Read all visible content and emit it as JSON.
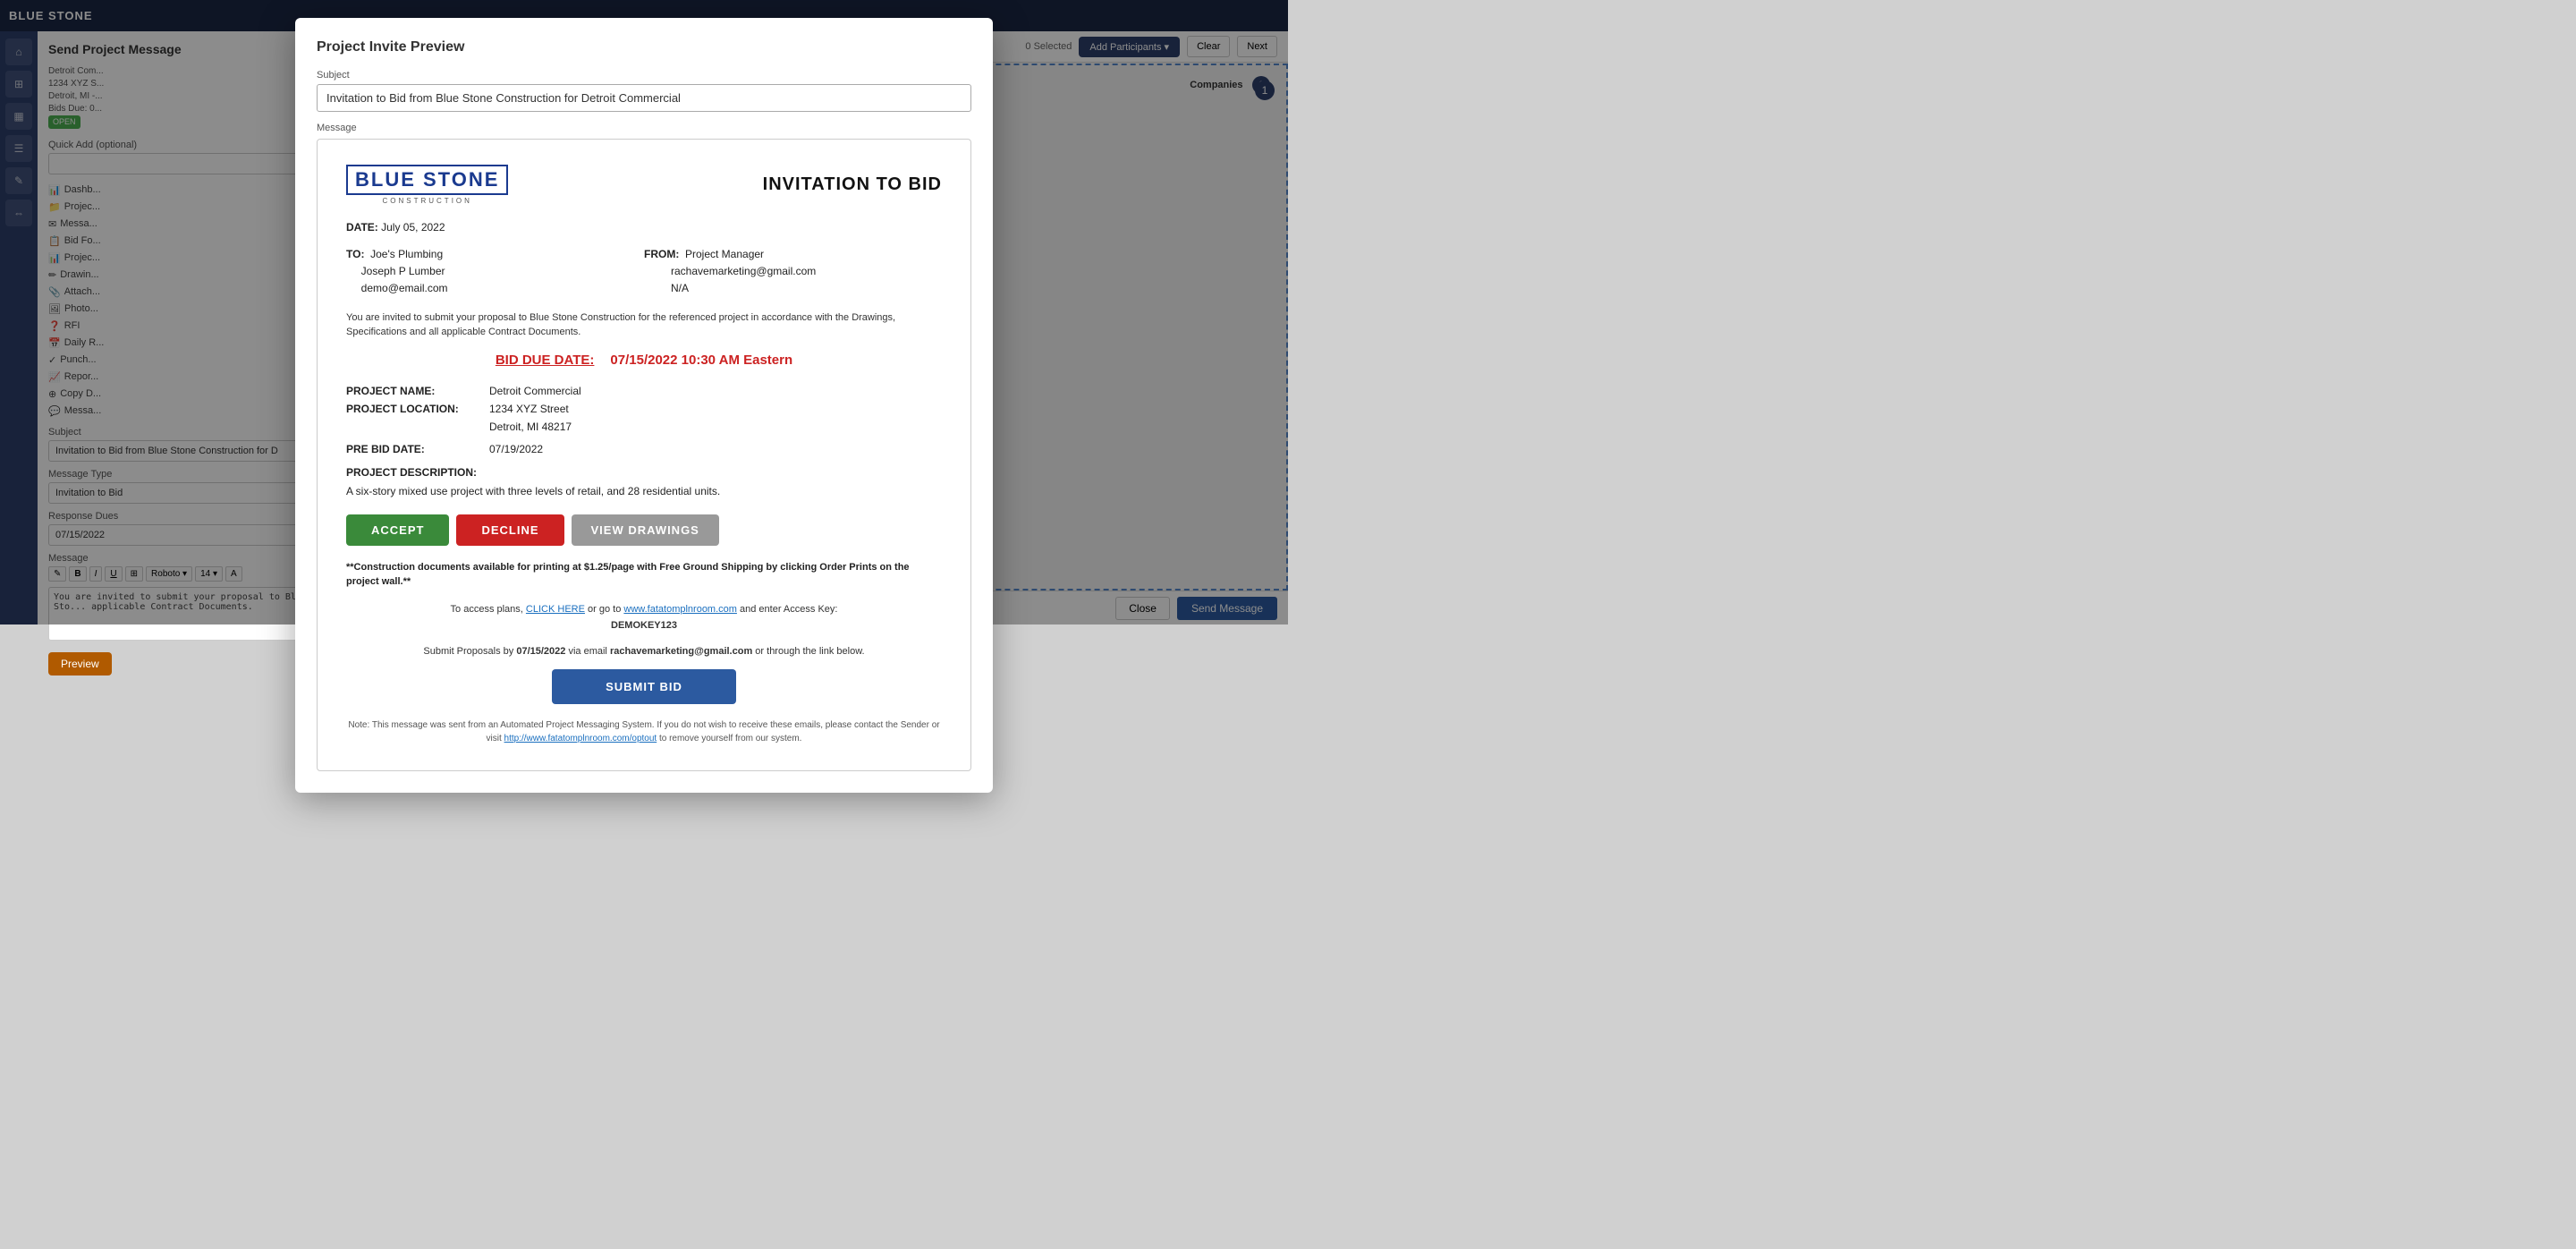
{
  "app": {
    "logo": "BLUE STONE",
    "title": "Send Project Message"
  },
  "send_panel": {
    "title": "Send Project Message",
    "project_info": {
      "company": "Detroit Com...",
      "address": "1234 XYZ S...",
      "city": "Detroit, MI -...",
      "bids_due": "Bids Due: 0...",
      "status": "OPEN"
    },
    "quick_add_label": "Quick Add (optional)",
    "quick_add_placeholder": "",
    "subject_label": "Subject",
    "subject_value": "Invitation to Bid from Blue Stone Construction for D",
    "message_type_label": "Message Type",
    "message_type_value": "Invitation to Bid",
    "response_dues_label": "Response Dues",
    "response_dues_value": "07/15/2022",
    "message_label": "Message",
    "message_body": "You are invited to submit your proposal to Blue Sto... applicable Contract Documents.",
    "toolbar_buttons": [
      "bold",
      "italic",
      "underline",
      "image",
      "font",
      "size",
      "color"
    ],
    "preview_label": "Preview"
  },
  "nav_links": [
    {
      "label": "Dashb..."
    },
    {
      "label": "Projec..."
    },
    {
      "label": "Messa..."
    },
    {
      "label": "Bid Fo..."
    },
    {
      "label": "Projec..."
    },
    {
      "label": "Drawin..."
    },
    {
      "label": "Attach..."
    },
    {
      "label": "Photo..."
    },
    {
      "label": "RFI"
    },
    {
      "label": "Daily R..."
    },
    {
      "label": "Punch..."
    },
    {
      "label": "Repor..."
    },
    {
      "label": "Copy D..."
    },
    {
      "label": "Messa..."
    }
  ],
  "right_header": {
    "selected_count": "0 Selected",
    "add_participants_label": "Add Participants ▾",
    "clear_label": "Clear",
    "next_label": "Next",
    "companies_label": "Companies",
    "companies_count": "1",
    "number_badge": "1"
  },
  "bottom_bar": {
    "close_label": "Close",
    "send_message_label": "Send Message"
  },
  "modal": {
    "title": "Project Invite Preview",
    "subject_label": "Subject",
    "subject_value": "Invitation to Bid from Blue Stone Construction for Detroit Commercial",
    "message_label": "Message",
    "email": {
      "logo_main": "BLUE STONE",
      "logo_sub": "CONSTRUCTION",
      "invitation_title": "INVITATION TO BID",
      "date_label": "DATE:",
      "date_value": "July 05, 2022",
      "to_label": "TO:",
      "to_line1": "Joe's Plumbing",
      "to_line2": "Joseph P Lumber",
      "to_line3": "demo@email.com",
      "from_label": "FROM:",
      "from_line1": "Project Manager",
      "from_line2": "rachavemarketing@gmail.com",
      "from_line3": "N/A",
      "body_text": "You are invited to submit your proposal to Blue Stone Construction for the referenced project in accordance with the Drawings, Specifications and all applicable Contract Documents.",
      "bid_due_label": "BID DUE DATE:",
      "bid_due_value": "07/15/2022 10:30 AM Eastern",
      "project_name_label": "PROJECT NAME:",
      "project_name_value": "Detroit Commercial",
      "project_location_label": "PROJECT LOCATION:",
      "project_location_line1": "1234 XYZ Street",
      "project_location_line2": "Detroit, MI 48217",
      "pre_bid_date_label": "PRE BID DATE:",
      "pre_bid_date_value": "07/19/2022",
      "project_description_label": "PROJECT DESCRIPTION:",
      "project_description_value": "A six-story mixed use project with three levels of retail, and 28 residential units.",
      "accept_label": "ACCEPT",
      "decline_label": "DECLINE",
      "view_drawings_label": "VIEW DRAWINGS",
      "print_notice": "**Construction documents available for printing at $1.25/page with Free Ground Shipping by clicking Order Prints on the project wall.**",
      "access_plans_text": "To access plans,",
      "click_here_label": "CLICK HERE",
      "click_here_url": "http://www.fatatomplnroom.com",
      "access_or_text": "or go to",
      "access_url": "www.fatatomplnroom.com",
      "access_enter_text": "and enter Access Key:",
      "access_key": "DEMOKEY123",
      "submit_by_text": "Submit Proposals by",
      "submit_by_date": "07/15/2022",
      "submit_via_text": "via email",
      "submit_email": "rachavemarketing@gmail.com",
      "submit_link_text": "or through the link below.",
      "submit_bid_label": "SUBMIT BID",
      "footer_note": "Note: This message was sent from an Automated Project Messaging System. If you do not wish to receive these emails, please contact the Sender or visit",
      "footer_link": "http://www.fatatomplnroom.com/optout",
      "footer_link_text": "http://www.fatatomplnroom.com/optout",
      "footer_end": "to remove yourself from our system."
    }
  }
}
